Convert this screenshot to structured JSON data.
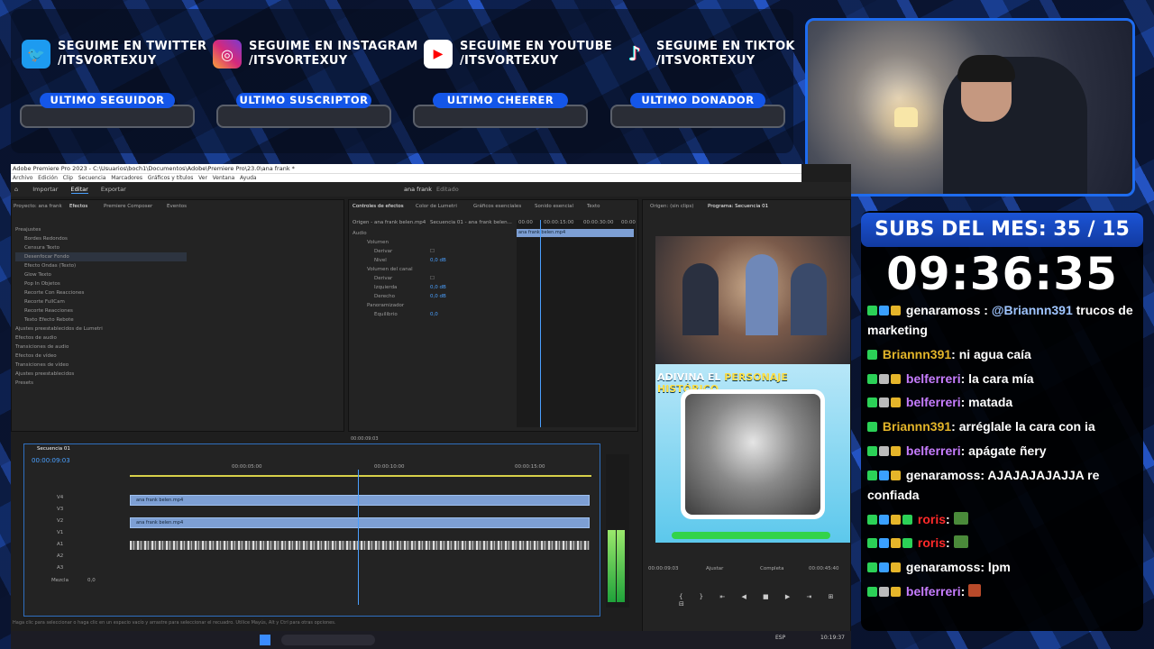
{
  "socials": [
    {
      "icon": "twitter-icon",
      "line1": "SEGUIME EN TWITTER",
      "line2": "/ITSVORTEXUY",
      "color": "#1d9bf0",
      "glyph": "🐦"
    },
    {
      "icon": "instagram-icon",
      "line1": "SEGUIME EN INSTAGRAM",
      "line2": "/ITSVORTEXUY",
      "color": "#d6297b",
      "glyph": "◎"
    },
    {
      "icon": "youtube-icon",
      "line1": "SEGUIME EN YOUTUBE",
      "line2": "/ITSVORTEXUY",
      "color": "#ff0000",
      "glyph": "▶"
    },
    {
      "icon": "tiktok-icon",
      "line1": "SEGUIME EN TIKTOK",
      "line2": "/ITSVORTEXUY",
      "color": "#111111",
      "glyph": "♪"
    }
  ],
  "pills": [
    "ULTIMO SEGUIDOR",
    "ULTIMO SUSCRIPTOR",
    "ULTIMO CHEERER",
    "ULTIMO DONADOR"
  ],
  "subs_header": "SUBS DEL MES: 35 / 15",
  "timer": "09:36:35",
  "chat": [
    {
      "user": "genaramoss",
      "color": "#ffffff",
      "text": ": @Briannn391 trucos de marketing",
      "mention": "@Briannn391"
    },
    {
      "user": "Briannn391",
      "color": "#e3b52a",
      "text": ": ni agua caía"
    },
    {
      "user": "belferreri",
      "color": "#c77dff",
      "text": ": la cara mía"
    },
    {
      "user": "belferreri",
      "color": "#c77dff",
      "text": ": matada"
    },
    {
      "user": "Briannn391",
      "color": "#e3b52a",
      "text": ": arréglale la cara con ia"
    },
    {
      "user": "belferreri",
      "color": "#c77dff",
      "text": ": apágate ñery"
    },
    {
      "user": "genaramoss",
      "color": "#ffffff",
      "text": ": AJAJAJAJAJJA re confiada"
    },
    {
      "user": "roris",
      "color": "#ff2a2a",
      "text": ":"
    },
    {
      "user": "roris",
      "color": "#ff2a2a",
      "text": ":"
    },
    {
      "user": "genaramoss",
      "color": "#ffffff",
      "text": ": lpm"
    },
    {
      "user": "belferreri",
      "color": "#c77dff",
      "text": ":"
    }
  ],
  "premiere": {
    "title": "Adobe Premiere Pro 2023 - C:\\Usuarios\\boch1\\Documentos\\Adobe\\Premiere Pro\\23.0\\ana frank *",
    "menu": [
      "Archivo",
      "Edición",
      "Clip",
      "Secuencia",
      "Marcadores",
      "Gráficos y títulos",
      "Ver",
      "Ventana",
      "Ayuda"
    ],
    "workspace_tabs": [
      "Importar",
      "Editar",
      "Exportar"
    ],
    "project_title": "ana frank",
    "project_status": "Editado",
    "effects_tabs": [
      "Proyecto: ana frank",
      "Efectos",
      "Premiere Composer",
      "Eventos"
    ],
    "effects_list": [
      "Preajustes",
      "Bordes Redondos",
      "Censura Texto",
      "Desenfocar Fondo",
      "Efecto Ondas (Texto)",
      "Glow Texto",
      "Pop In Objetos",
      "Recorte Con Reacciones",
      "Recorte FullCam",
      "Recorte Reacciones",
      "Texto Efecto Rebote",
      "Ajustes preestablecidos de Lumetri",
      "Efectos de audio",
      "Transiciones de audio",
      "Efectos de vídeo",
      "Transiciones de vídeo",
      "Ajustes preestablecidos",
      "Presets"
    ],
    "controls_tabs": [
      "Controles de efectos",
      "Color de Lumetri",
      "Gráficos esenciales",
      "Sonido esencial",
      "Texto"
    ],
    "controls_source": "Origen - ana frank belen.mp4",
    "controls_seq": "Secuencia 01 - ana frank belen...",
    "controls_rows": [
      "Audio",
      "Volumen",
      "Derivar",
      "Nivel",
      "Volumen del canal",
      "Derivar",
      "Izquierda",
      "Derecho",
      "Panoramizador",
      "Equilibrio"
    ],
    "controls_values": [
      "0,0 dB",
      "0,0 dB",
      "0,0 dB",
      "0,0"
    ],
    "mini_clip": "ana frank belen.mp4",
    "mini_times": [
      "00:00",
      "00:00:15:00",
      "00:00:30:00",
      "00:00"
    ],
    "mini_timecode": "00:00:09:03",
    "monitor_tabs": [
      "Origen: (sin clips)",
      "Programa: Secuencia 01"
    ],
    "monitor_timecode": "00:00:09:03",
    "monitor_fit": "Ajustar",
    "monitor_quality": "Completa",
    "monitor_duration": "00:00:45:40",
    "game_header": "ADIVINA EL",
    "game_highlight": "PERSONAJE HISTÓRICO",
    "sequence_tab": "Secuencia 01",
    "sequence_timecode": "00:00:09:03",
    "ruler": [
      "00:00:05:00",
      "00:00:10:00",
      "00:00:15:00"
    ],
    "tracks": [
      "V4",
      "V3",
      "V2",
      "V1",
      "A1",
      "A2",
      "A3"
    ],
    "clip_names": [
      "ana frank belen.mp4",
      "ana frank belen.mp4"
    ],
    "mix_label": "Mezcla",
    "mix_value": "0,0",
    "status_bar": "Haga clic para seleccionar o haga clic en un espacio vacío y arrastre para seleccionar el recuadro. Utilice Mayús, Alt y Ctrl para otras opciones.",
    "meter_labels": [
      "0",
      "-6",
      "-12",
      "-18",
      "-24",
      "-30",
      "-36",
      "-42",
      "-48",
      "-54"
    ]
  },
  "taskbar": {
    "lang": "ESP",
    "time": "10:19:37"
  }
}
